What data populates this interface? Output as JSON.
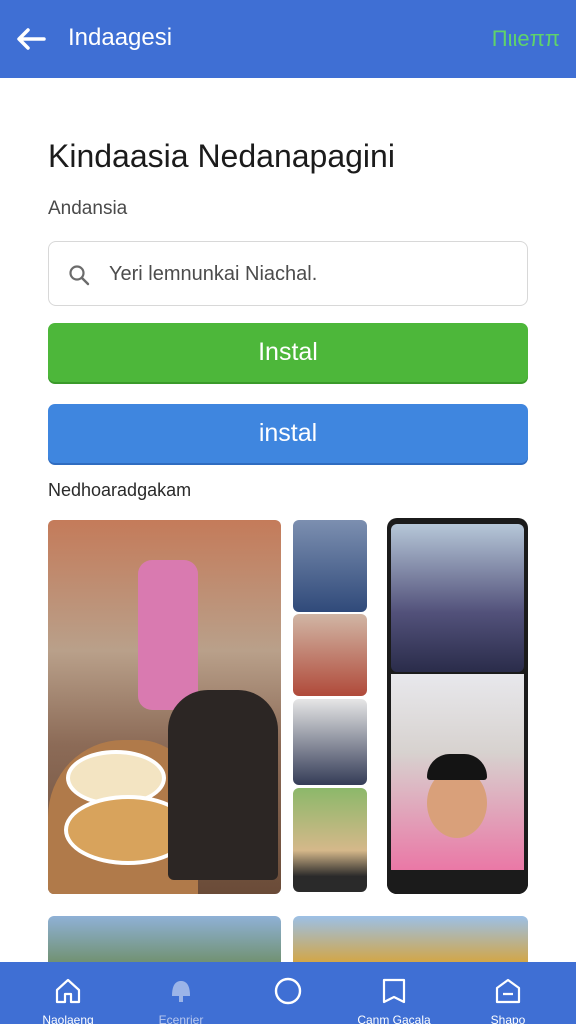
{
  "appbar": {
    "title": "Indaagesi",
    "action_label": "Πιιeππ"
  },
  "page": {
    "title": "Kindaasia Nedanapagini",
    "subtitle": "Andansia"
  },
  "search": {
    "placeholder": "Yeri lemnunkai Niachal."
  },
  "buttons": {
    "primary_label": "Instal",
    "secondary_label": "instal"
  },
  "gallery": {
    "label": "Nedhoaradgakam"
  },
  "tabs": [
    {
      "label": "Naolaeng",
      "icon": "home-icon"
    },
    {
      "label": "Ecenrier",
      "icon": "bell-icon"
    },
    {
      "label": "",
      "icon": "circle-icon"
    },
    {
      "label": "Canm Gacala",
      "icon": "book-icon"
    },
    {
      "label": "Shapo",
      "icon": "shop-icon"
    }
  ],
  "colors": {
    "appbar": "#3f6fd4",
    "primary_button": "#4db73a",
    "secondary_button": "#3f86df"
  }
}
